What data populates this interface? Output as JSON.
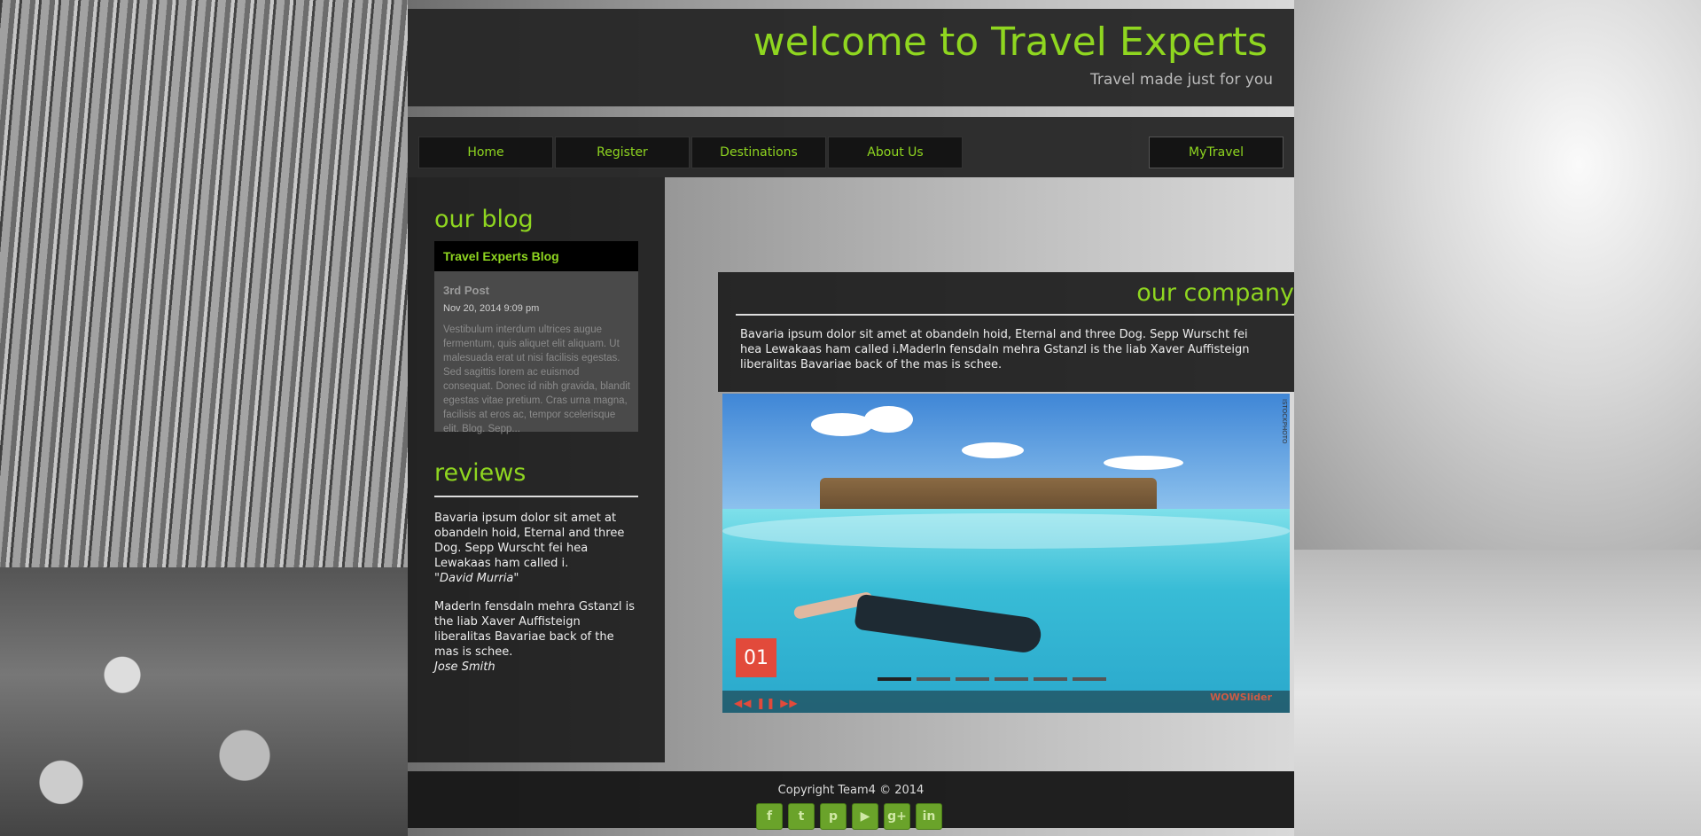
{
  "header": {
    "title": "welcome to Travel Experts",
    "tagline": "Travel made just for you"
  },
  "nav": {
    "home": "Home",
    "register": "Register",
    "destinations": "Destinations",
    "about": "About Us",
    "mytravel": "MyTravel"
  },
  "sidebar": {
    "blog_heading": "our blog",
    "blog_widget_title": "Travel Experts Blog",
    "blog_post_title": "3rd Post",
    "blog_post_date": "Nov 20, 2014 9:09 pm",
    "blog_post_excerpt": "Vestibulum interdum ultrices augue fermentum, quis aliquet elit aliquam. Ut malesuada erat ut nisi facilisis egestas. Sed sagittis lorem ac euismod consequat. Donec id nibh gravida, blandit egestas vitae pretium. Cras urna magna, facilisis at eros ac, tempor scelerisque elit. Blog. Sepp...",
    "reviews_heading": "reviews",
    "review1_text": "Bavaria ipsum dolor sit amet at obandeln hoid, Eternal and three Dog. Sepp Wurscht fei hea Lewakaas ham called i.",
    "review1_author": "\"David Murria\"",
    "review2_text": "Maderln fensdaln mehra Gstanzl is the liab Xaver Auffisteign liberalitas Bavariae back of the mas is schee.",
    "review2_author": "Jose Smith"
  },
  "company": {
    "heading": "our company",
    "text": "Bavaria ipsum dolor sit amet at obandeln hoid, Eternal and three Dog. Sepp Wurscht fei hea Lewakaas ham called i.Maderln fensdaln mehra Gstanzl is the liab Xaver Auffisteign liberalitas Bavariae back of the mas is schee."
  },
  "slider": {
    "slide_number": "01",
    "brand": "WOWSlider",
    "watermark": "ISTOCKPHOTO"
  },
  "footer": {
    "copyright": "Copyright Team4 © 2014",
    "social": [
      "f",
      "t",
      "p",
      "▶",
      "g+",
      "in"
    ]
  }
}
